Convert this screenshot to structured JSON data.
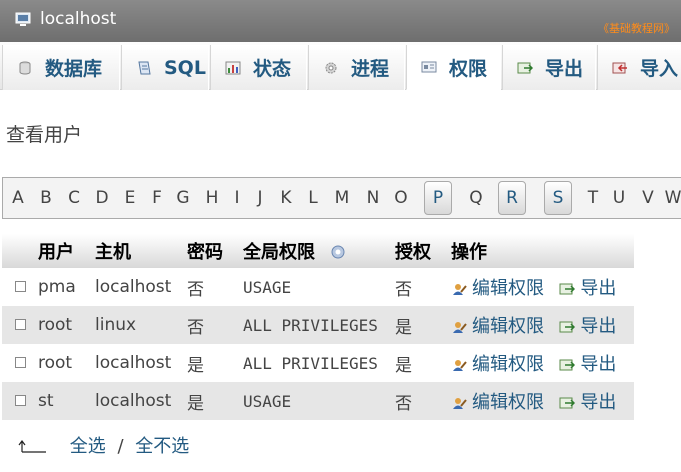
{
  "titlebar": {
    "server_name": "localhost",
    "watermark": "《基础教程网》"
  },
  "tabs": [
    {
      "label": "数据库",
      "icon": "database-icon"
    },
    {
      "label": "SQL",
      "icon": "sql-icon"
    },
    {
      "label": "状态",
      "icon": "status-icon"
    },
    {
      "label": "进程",
      "icon": "process-icon"
    },
    {
      "label": "权限",
      "icon": "privileges-icon",
      "active": true
    },
    {
      "label": "导出",
      "icon": "export-icon"
    },
    {
      "label": "导入",
      "icon": "import-icon"
    }
  ],
  "page_title": "查看用户",
  "letters": [
    "A",
    "B",
    "C",
    "D",
    "E",
    "F",
    "G",
    "H",
    "I",
    "J",
    "K",
    "L",
    "M",
    "N",
    "O",
    "P",
    "Q",
    "R",
    "S",
    "T",
    "U",
    "V",
    "W"
  ],
  "letters_with_users": [
    "P",
    "R",
    "S"
  ],
  "table": {
    "headers": {
      "user": "用户",
      "host": "主机",
      "password": "密码",
      "global_privileges": "全局权限",
      "grant": "授权",
      "action": "操作"
    },
    "rows": [
      {
        "user": "pma",
        "host": "localhost",
        "password": "否",
        "privileges": "USAGE",
        "grant": "否",
        "edit": "编辑权限",
        "export": "导出"
      },
      {
        "user": "root",
        "host": "linux",
        "password": "否",
        "privileges": "ALL PRIVILEGES",
        "grant": "是",
        "edit": "编辑权限",
        "export": "导出"
      },
      {
        "user": "root",
        "host": "localhost",
        "password": "是",
        "privileges": "ALL PRIVILEGES",
        "grant": "是",
        "edit": "编辑权限",
        "export": "导出"
      },
      {
        "user": "st",
        "host": "localhost",
        "password": "是",
        "privileges": "USAGE",
        "grant": "否",
        "edit": "编辑权限",
        "export": "导出"
      }
    ]
  },
  "footer": {
    "select_all": "全选",
    "separator": "/",
    "unselect_all": "全不选"
  },
  "colors": {
    "link": "#235a81",
    "no_password": "#d40000",
    "titlebar": "#7a7a7a",
    "watermark": "#ff8c1a",
    "row_alt": "#e6e6e6"
  }
}
